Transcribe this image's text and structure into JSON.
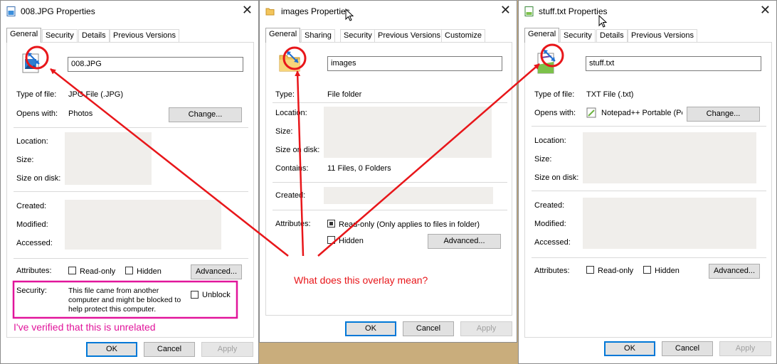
{
  "dialogs": {
    "jpg": {
      "title": "008.JPG Properties",
      "tabs": [
        "General",
        "Security",
        "Details",
        "Previous Versions"
      ],
      "filename": "008.JPG",
      "type_label": "Type of file:",
      "type_value": "JPG File (.JPG)",
      "opens_label": "Opens with:",
      "opens_value": "Photos",
      "change_label": "Change...",
      "location_label": "Location:",
      "size_label": "Size:",
      "size_disk_label": "Size on disk:",
      "created_label": "Created:",
      "modified_label": "Modified:",
      "accessed_label": "Accessed:",
      "attributes_label": "Attributes:",
      "readonly_label": "Read-only",
      "hidden_label": "Hidden",
      "advanced_label": "Advanced...",
      "security_label": "Security:",
      "security_text_1": "This file came from another",
      "security_text_2": "computer and might be blocked to",
      "security_text_3": "help protect this computer.",
      "unblock_label": "Unblock",
      "ok_label": "OK",
      "cancel_label": "Cancel",
      "apply_label": "Apply"
    },
    "folder": {
      "title": "images Properties",
      "tabs": [
        "General",
        "Sharing",
        "Security",
        "Previous Versions",
        "Customize"
      ],
      "filename": "images",
      "type_label": "Type:",
      "type_value": "File folder",
      "location_label": "Location:",
      "size_label": "Size:",
      "size_disk_label": "Size on disk:",
      "contains_label": "Contains:",
      "contains_value": "11 Files, 0 Folders",
      "created_label": "Created:",
      "attributes_label": "Attributes:",
      "readonly_label": "Read-only (Only applies to files in folder)",
      "hidden_label": "Hidden",
      "advanced_label": "Advanced...",
      "ok_label": "OK",
      "cancel_label": "Cancel",
      "apply_label": "Apply"
    },
    "txt": {
      "title": "stuff.txt Properties",
      "tabs": [
        "General",
        "Security",
        "Details",
        "Previous Versions"
      ],
      "filename": "stuff.txt",
      "type_label": "Type of file:",
      "type_value": "TXT File (.txt)",
      "opens_label": "Opens with:",
      "opens_value": "Notepad++ Portable (Pc",
      "change_label": "Change...",
      "location_label": "Location:",
      "size_label": "Size:",
      "size_disk_label": "Size on disk:",
      "created_label": "Created:",
      "modified_label": "Modified:",
      "accessed_label": "Accessed:",
      "attributes_label": "Attributes:",
      "readonly_label": "Read-only",
      "hidden_label": "Hidden",
      "advanced_label": "Advanced...",
      "ok_label": "OK",
      "cancel_label": "Cancel",
      "apply_label": "Apply"
    }
  },
  "annotations": {
    "question": "What does this overlay mean?",
    "note": "I've verified that this is unrelated"
  },
  "colors": {
    "annotation_red": "#e8161a",
    "annotation_magenta": "#e1159b",
    "accent_blue": "#0078d7",
    "background": "#c9ad7c"
  },
  "icons": {
    "jpg": "image-file-icon",
    "folder": "folder-icon",
    "txt": "text-file-icon",
    "overlay": "blue-arrows-overlay-icon"
  }
}
